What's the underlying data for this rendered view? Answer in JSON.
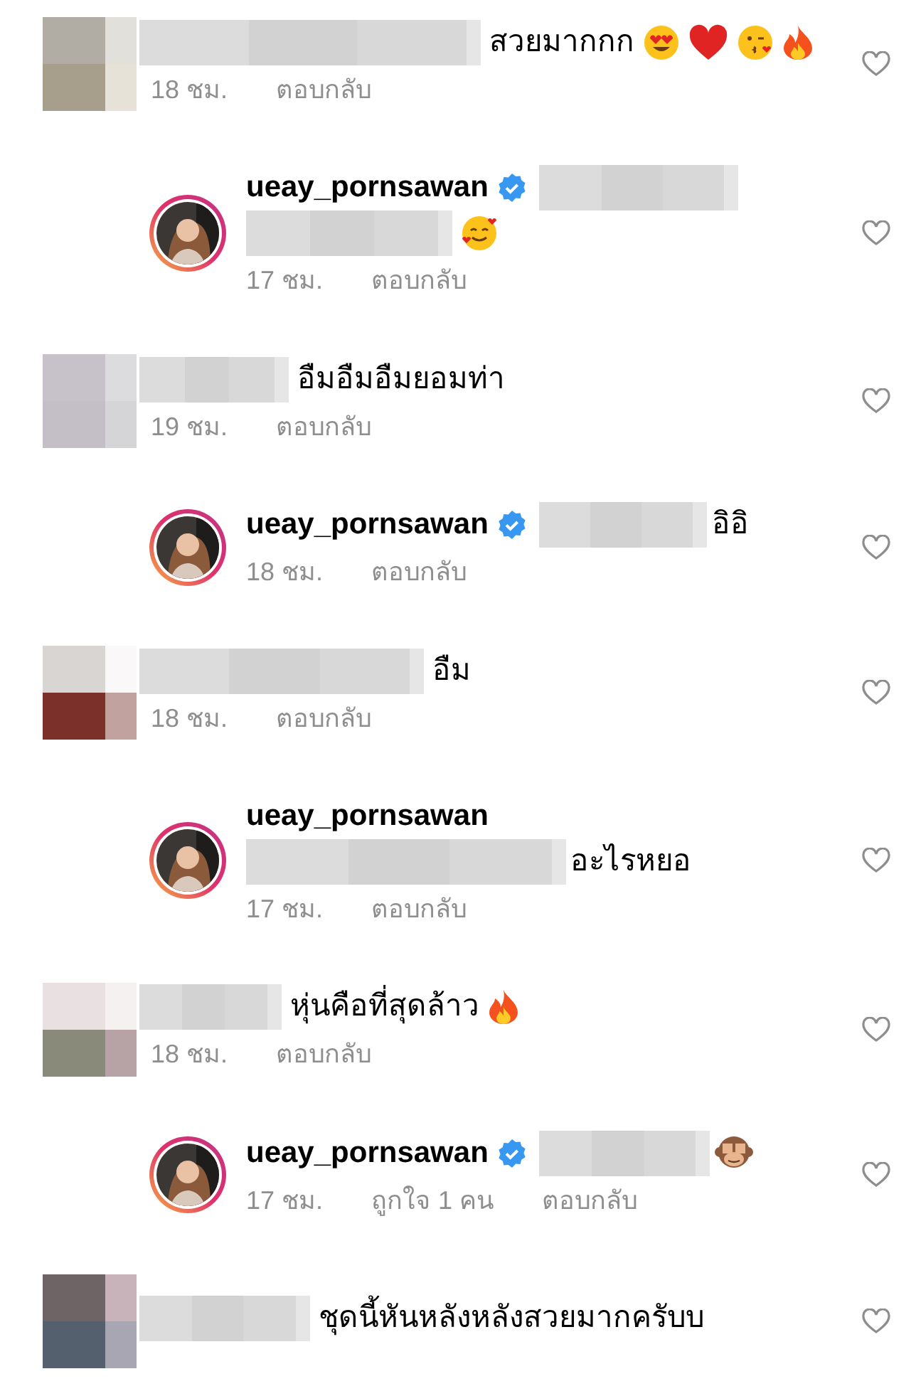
{
  "comments": [
    {
      "kind": "comment",
      "text": "สวยมากกก",
      "time": "18 ชม.",
      "reply": "ตอบกลับ",
      "liked": false
    },
    {
      "kind": "reply",
      "username": "ueay_pornsawan",
      "verified": true,
      "time": "17 ชม.",
      "reply": "ตอบกลับ",
      "liked": false
    },
    {
      "kind": "comment",
      "text": "อืมอืมอืมยอมท่า",
      "time": "19 ชม.",
      "reply": "ตอบกลับ",
      "liked": false
    },
    {
      "kind": "reply",
      "username": "ueay_pornsawan",
      "verified": true,
      "text": "อิอิ",
      "time": "18 ชม.",
      "reply": "ตอบกลับ",
      "liked": false
    },
    {
      "kind": "comment",
      "text": "อืม",
      "time": "18 ชม.",
      "reply": "ตอบกลับ",
      "liked": false
    },
    {
      "kind": "reply",
      "username": "ueay_pornsawan",
      "verified": false,
      "text": "อะไรหยอ",
      "time": "17 ชม.",
      "reply": "ตอบกลับ",
      "liked": false
    },
    {
      "kind": "comment",
      "text": "หุ่นคือที่สุดล้าว",
      "time": "18 ชม.",
      "reply": "ตอบกลับ",
      "liked": false
    },
    {
      "kind": "reply",
      "username": "ueay_pornsawan",
      "verified": true,
      "time": "17 ชม.",
      "likes": "ถูกใจ 1 คน",
      "reply": "ตอบกลับ",
      "liked": false
    },
    {
      "kind": "comment",
      "text": "ชุดนี้หันหลังหลังสวยมากครับบ",
      "liked": false
    }
  ]
}
